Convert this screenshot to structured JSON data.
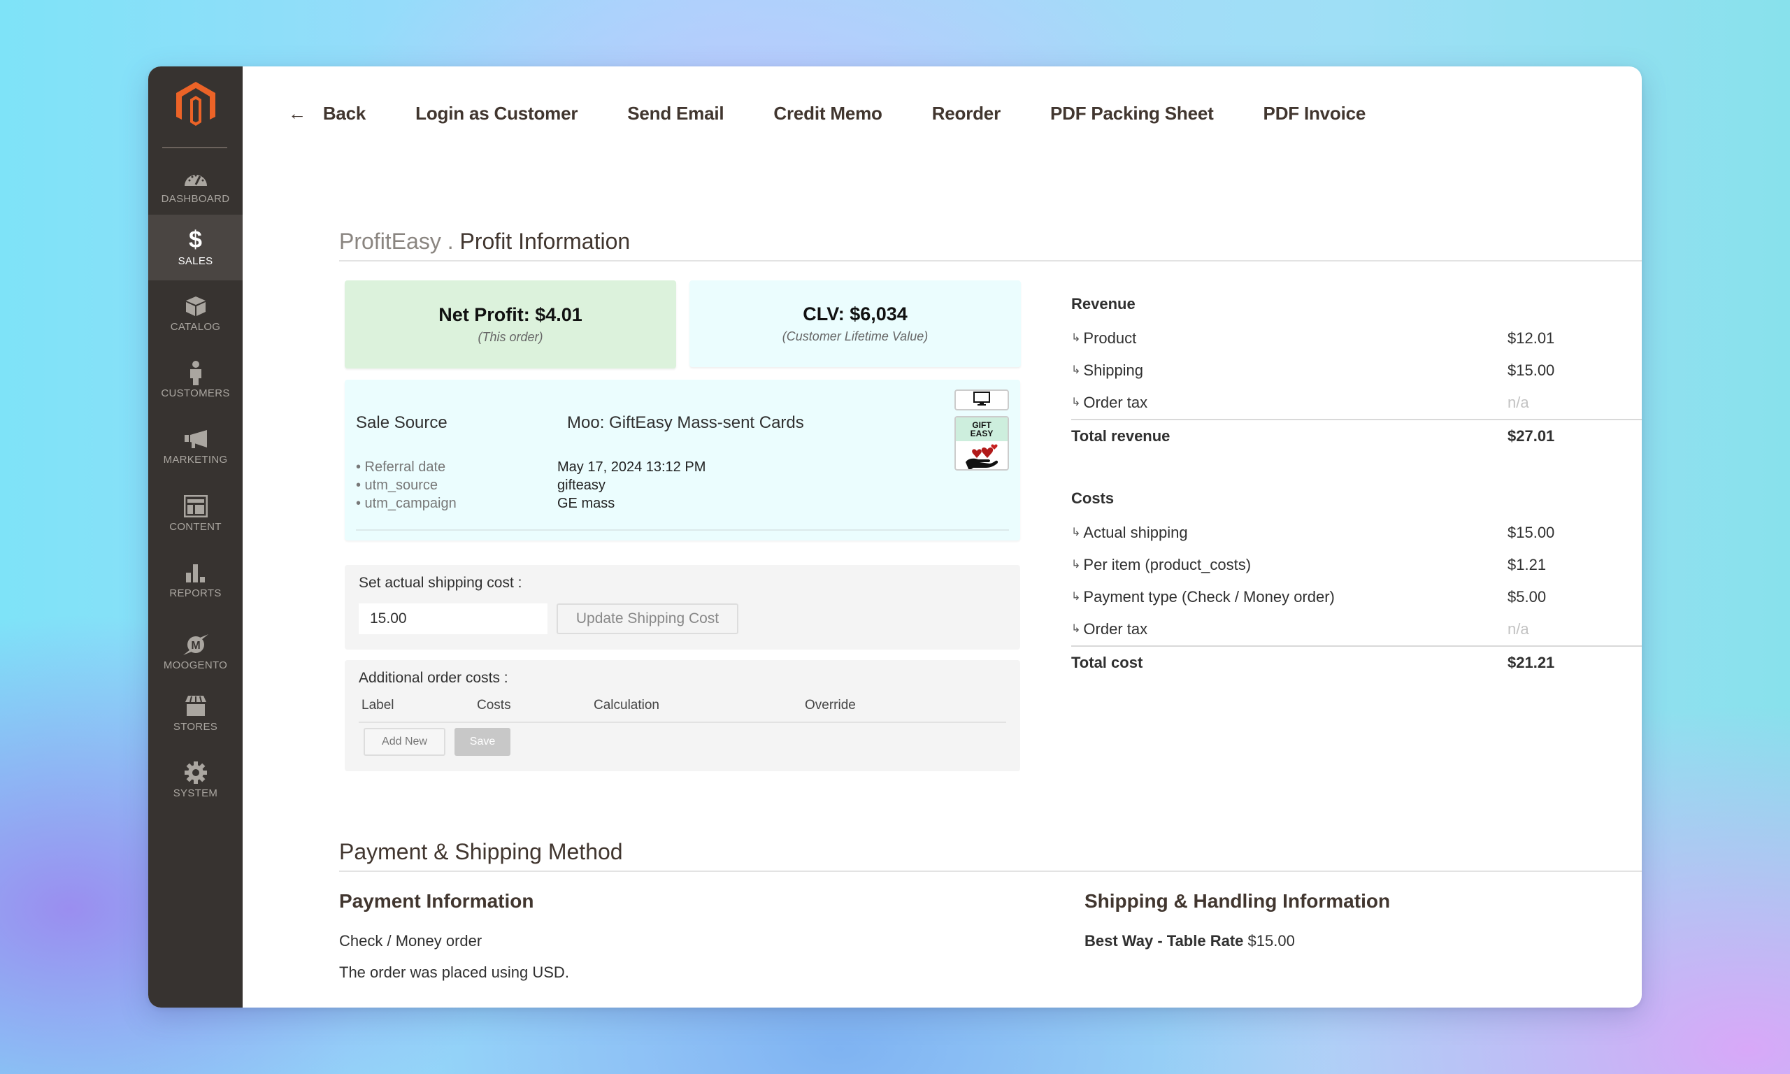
{
  "sidebar": {
    "logo": "magento-logo",
    "items": [
      {
        "label": "Dashboard",
        "icon": "dashboard-icon"
      },
      {
        "label": "Sales",
        "icon": "dollar-icon",
        "active": true
      },
      {
        "label": "Catalog",
        "icon": "box-icon"
      },
      {
        "label": "Customers",
        "icon": "person-icon"
      },
      {
        "label": "Marketing",
        "icon": "megaphone-icon"
      },
      {
        "label": "Content",
        "icon": "layout-icon"
      },
      {
        "label": "Reports",
        "icon": "bar-chart-icon"
      },
      {
        "label": "Moogento",
        "icon": "moogento-icon"
      },
      {
        "label": "Stores",
        "icon": "storefront-icon"
      },
      {
        "label": "System",
        "icon": "gear-icon"
      }
    ]
  },
  "toolbar": {
    "back_icon": "←",
    "back": "Back",
    "login_as_customer": "Login as Customer",
    "send_email": "Send Email",
    "credit_memo": "Credit Memo",
    "reorder": "Reorder",
    "pdf_packing_sheet": "PDF Packing Sheet",
    "pdf_invoice": "PDF Invoice"
  },
  "profit": {
    "title_prefix": "ProfitEasy .",
    "title": "Profit Information",
    "net_profit_card": {
      "value": "Net Profit: $4.01",
      "caption": "(This order)",
      "color": "#dcf2dc"
    },
    "clv_card": {
      "value": "CLV: $6,034",
      "caption": "(Customer Lifetime Value)",
      "color": "#ebfdfe"
    },
    "sale_source": {
      "label": "Sale Source",
      "value": "Moo: GiftEasy Mass-sent Cards",
      "device_icon": "desktop-icon",
      "logo_text_line1": "GIFT",
      "logo_text_line2": "EASY",
      "details": [
        {
          "key": "• Referral date",
          "value": "May 17, 2024 13:12 PM"
        },
        {
          "key": "• utm_source",
          "value": "gifteasy"
        },
        {
          "key": "• utm_campaign",
          "value": "GE mass"
        }
      ]
    },
    "shipping_cost": {
      "label": "Set actual shipping cost :",
      "value": "15.00",
      "button": "Update Shipping Cost"
    },
    "additional_costs": {
      "label": "Additional order costs :",
      "columns": [
        "Label",
        "Costs",
        "Calculation",
        "Override"
      ],
      "add_new": "Add New",
      "save": "Save"
    },
    "revenue": {
      "heading": "Revenue",
      "rows": [
        {
          "label": "Product",
          "value": "$12.01"
        },
        {
          "label": "Shipping",
          "value": "$15.00"
        },
        {
          "label": "Order tax",
          "value": "n/a"
        }
      ],
      "total_label": "Total revenue",
      "total_value": "$27.01"
    },
    "costs": {
      "heading": "Costs",
      "rows": [
        {
          "label": "Actual shipping",
          "value": "$15.00"
        },
        {
          "label": "Per item (product_costs)",
          "value": "$1.21"
        },
        {
          "label": "Payment type (Check / Money order)",
          "value": "$5.00"
        },
        {
          "label": "Order tax",
          "value": "n/a"
        }
      ],
      "total_label": "Total cost",
      "total_value": "$21.21"
    }
  },
  "payment_shipping": {
    "title": "Payment & Shipping Method",
    "payment_heading": "Payment Information",
    "payment_method": "Check / Money order",
    "currency_note": "The order was placed using USD.",
    "shipping_heading": "Shipping & Handling Information",
    "shipping_method": "Best Way - Table Rate",
    "shipping_price": "$15.00"
  }
}
